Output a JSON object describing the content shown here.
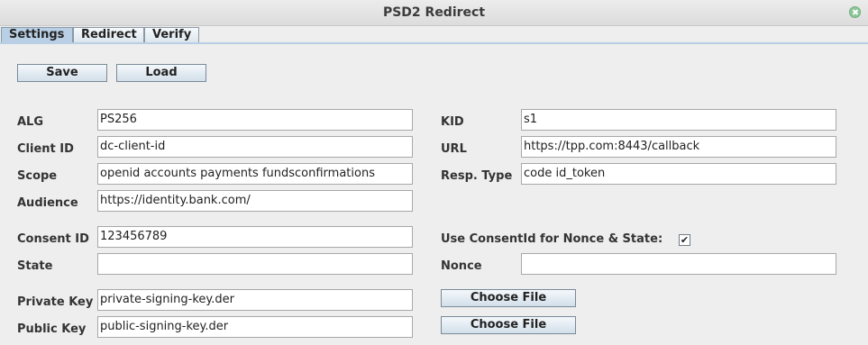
{
  "window": {
    "title": "PSD2 Redirect"
  },
  "tabs": [
    {
      "label": "Settings"
    },
    {
      "label": "Redirect"
    },
    {
      "label": "Verify"
    }
  ],
  "toolbar": {
    "save_label": "Save",
    "load_label": "Load"
  },
  "left": {
    "alg": {
      "label": "ALG",
      "value": "PS256"
    },
    "client_id": {
      "label": "Client ID",
      "value": "dc-client-id"
    },
    "scope": {
      "label": "Scope",
      "value": "openid accounts payments fundsconfirmations"
    },
    "audience": {
      "label": "Audience",
      "value": "https://identity.bank.com/"
    },
    "consent_id": {
      "label": "Consent ID",
      "value": "123456789"
    },
    "state": {
      "label": "State",
      "value": ""
    },
    "private_key": {
      "label": "Private Key",
      "value": "private-signing-key.der"
    },
    "public_key": {
      "label": "Public Key",
      "value": "public-signing-key.der"
    }
  },
  "right": {
    "kid": {
      "label": "KID",
      "value": "s1"
    },
    "url": {
      "label": "URL",
      "value": "https://tpp.com:8443/callback"
    },
    "resp_type": {
      "label": "Resp. Type",
      "value": "code id_token"
    },
    "use_consent": {
      "label": "Use ConsentId for Nonce & State:",
      "checked": true
    },
    "nonce": {
      "label": "Nonce",
      "value": ""
    },
    "choose_file_label": "Choose File"
  }
}
